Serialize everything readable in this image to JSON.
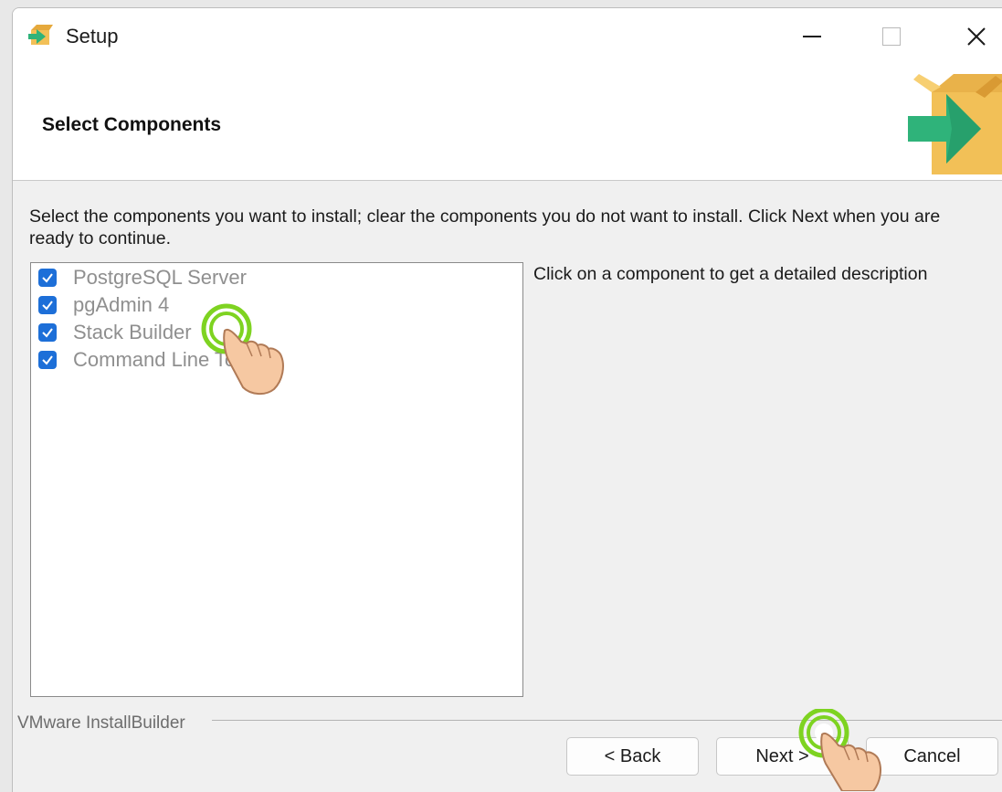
{
  "window": {
    "title": "Setup",
    "controls": [
      "minimize",
      "maximize",
      "close"
    ]
  },
  "header": {
    "title": "Select Components",
    "graphic_icon": "box-arrow-icon"
  },
  "instructions": "Select the components you want to install; clear the components you do not want to install. Click Next when you are ready to continue.",
  "components": [
    {
      "label": "PostgreSQL Server",
      "checked": true
    },
    {
      "label": "pgAdmin 4",
      "checked": true
    },
    {
      "label": "Stack Builder",
      "checked": true
    },
    {
      "label": "Command Line Tools",
      "checked": true
    }
  ],
  "description_hint": "Click on a component to get a detailed description",
  "footer": {
    "brand": "VMware InstallBuilder",
    "buttons": {
      "back": "< Back",
      "next": "Next >",
      "cancel": "Cancel"
    }
  },
  "colors": {
    "checkbox": "#1d6fd8",
    "tap_ring": "#7ed321",
    "arrow": "#2fb37a",
    "box": "#f2c057"
  },
  "annotations": [
    {
      "icon": "tap-hand-icon",
      "target": "Stack Builder"
    },
    {
      "icon": "tap-hand-icon",
      "target": "Next >"
    }
  ]
}
